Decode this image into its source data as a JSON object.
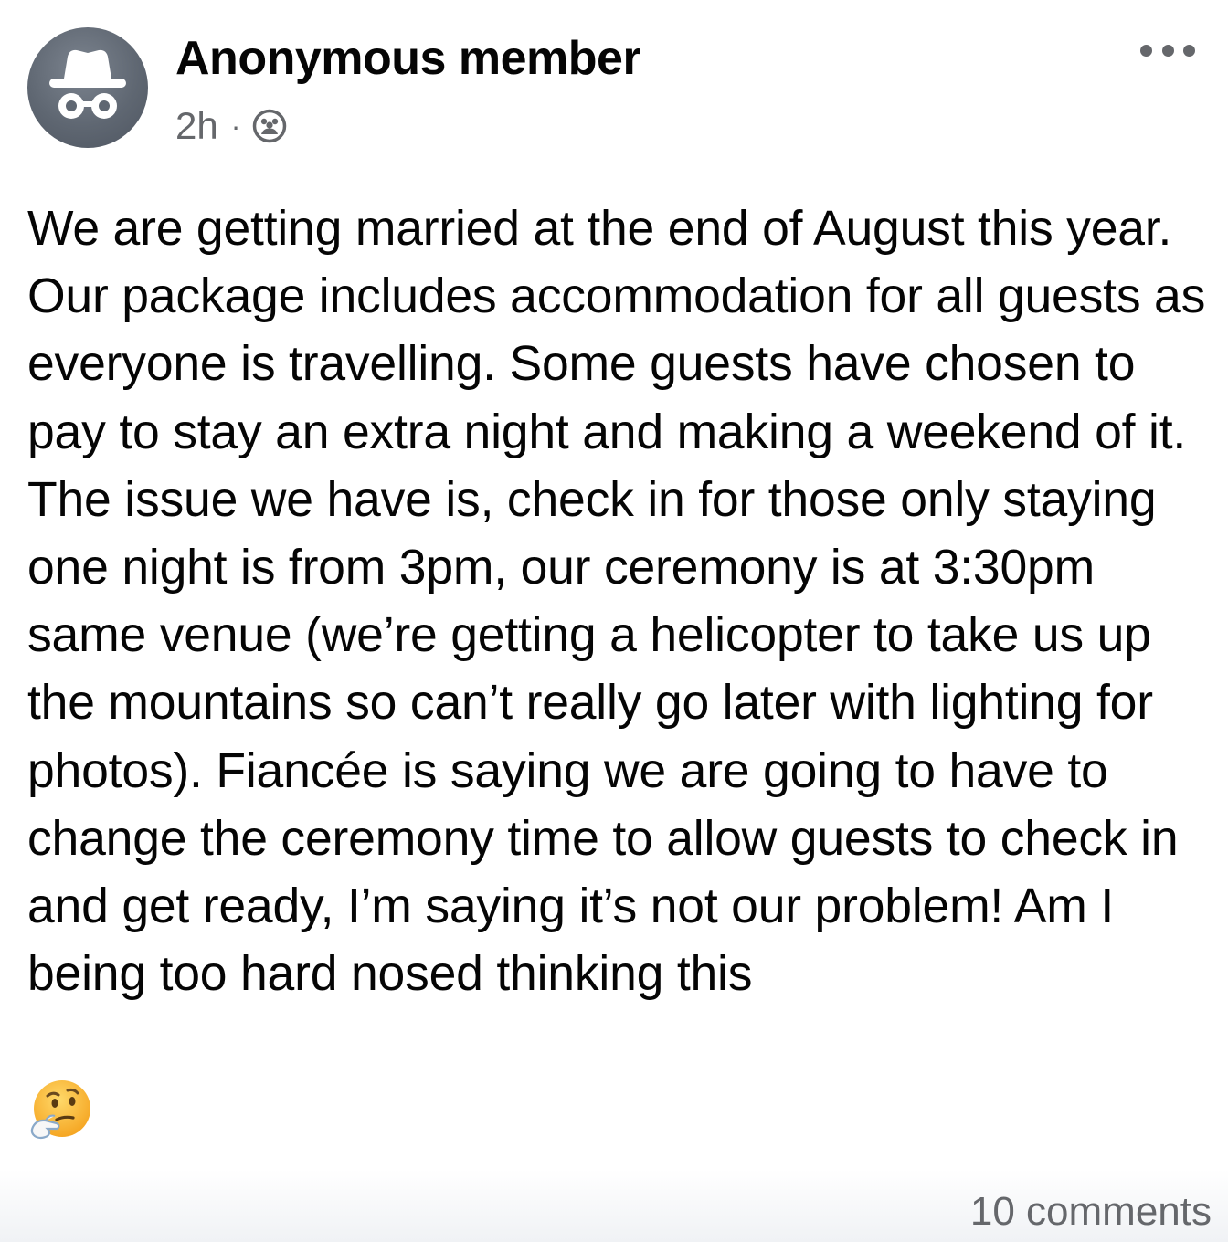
{
  "post": {
    "author_name": "Anonymous member",
    "avatar_icon": "anonymous-incognito-icon",
    "timestamp": "2h",
    "separator": "·",
    "privacy_icon": "group-members-icon",
    "more_icon": "more-options-icon",
    "body_text": "We are getting married at the end of August this year.  Our package includes accommodation for all guests as everyone is travelling.  Some guests have chosen to pay to stay an extra night and making a weekend of it.  The issue we have is, check in for those only staying one night is from 3pm, our ceremony is at 3:30pm same venue (we’re getting a helicopter to take us up the mountains so can’t really go later with lighting for photos).  Fiancée is saying we are going to have to change the ceremony time to allow guests to check in and get ready, I’m saying it’s not our problem!  Am I being too hard nosed thinking this",
    "emoji": "thinking-face-icon",
    "comments_count": "10 comments"
  },
  "colors": {
    "text_primary": "#050505",
    "text_secondary": "#65676b",
    "avatar_bg": "#5f6772",
    "background": "#ffffff"
  }
}
